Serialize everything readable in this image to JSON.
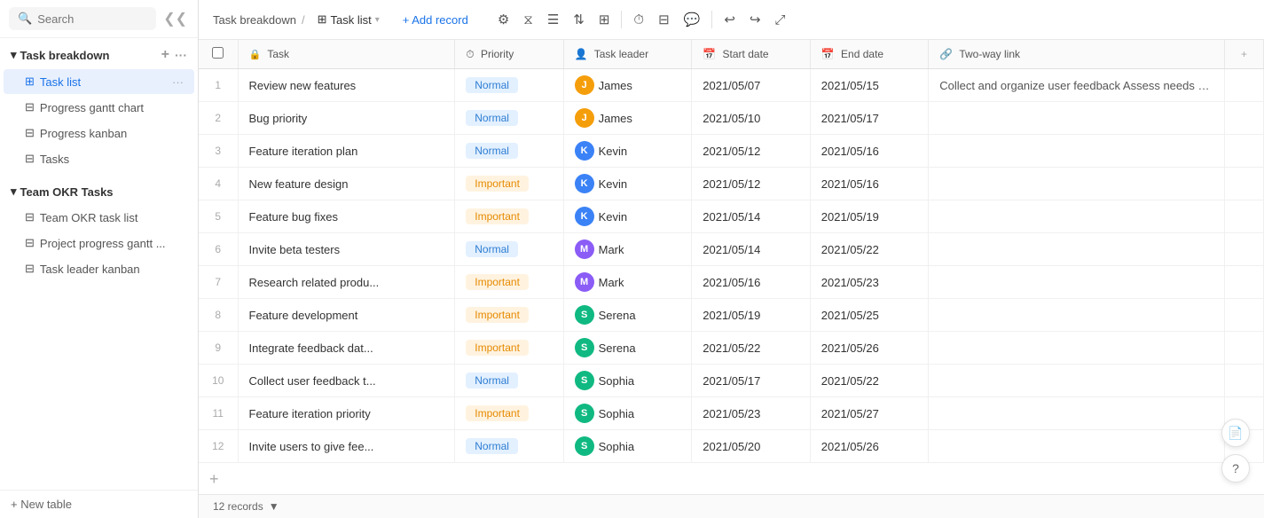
{
  "sidebar": {
    "search_placeholder": "Search",
    "collapse_icon": "❮❮",
    "groups": [
      {
        "label": "Task breakdown",
        "items": [
          {
            "id": "task-list",
            "label": "Task list",
            "icon": "⊞",
            "active": true
          },
          {
            "id": "progress-gantt",
            "label": "Progress gantt chart",
            "icon": "⊟"
          },
          {
            "id": "progress-kanban",
            "label": "Progress kanban",
            "icon": "⊟"
          },
          {
            "id": "tasks",
            "label": "Tasks",
            "icon": "⊟"
          }
        ]
      },
      {
        "label": "Team OKR Tasks",
        "items": [
          {
            "id": "team-okr-task-list",
            "label": "Team OKR task list",
            "icon": "⊟"
          },
          {
            "id": "project-progress-gantt",
            "label": "Project progress gantt ...",
            "icon": "⊟"
          },
          {
            "id": "task-leader-kanban",
            "label": "Task leader kanban",
            "icon": "⊟"
          }
        ]
      }
    ],
    "new_table_label": "+ New table"
  },
  "topbar": {
    "breadcrumb_parent": "Task breakdown",
    "breadcrumb_sep": "/",
    "view_icon": "⊞",
    "view_label": "Task list",
    "add_record_label": "+ Add record",
    "tools": [
      {
        "id": "settings",
        "icon": "⚙"
      },
      {
        "id": "filter",
        "icon": "⧖"
      },
      {
        "id": "fields",
        "icon": "☰"
      },
      {
        "id": "sort",
        "icon": "⇅"
      },
      {
        "id": "group",
        "icon": "⊞"
      },
      {
        "id": "clock",
        "icon": "⏱"
      },
      {
        "id": "table2",
        "icon": "⊟"
      },
      {
        "id": "chat",
        "icon": "💬"
      },
      {
        "id": "undo",
        "icon": "↩"
      },
      {
        "id": "redo",
        "icon": "↪"
      },
      {
        "id": "expand",
        "icon": "⤢"
      }
    ]
  },
  "table": {
    "columns": [
      {
        "id": "checkbox",
        "label": ""
      },
      {
        "id": "task",
        "label": "Task",
        "icon": "Ξ"
      },
      {
        "id": "priority",
        "label": "Priority",
        "icon": "⏱"
      },
      {
        "id": "task-leader",
        "label": "Task leader",
        "icon": "👤"
      },
      {
        "id": "start-date",
        "label": "Start date",
        "icon": "📅"
      },
      {
        "id": "end-date",
        "label": "End date",
        "icon": "📅"
      },
      {
        "id": "two-way-link",
        "label": "Two-way link",
        "icon": "🔗"
      }
    ],
    "rows": [
      {
        "num": 1,
        "task": "Review new features",
        "priority": "Normal",
        "leader": "James",
        "leader_initial": "J",
        "leader_color": "j",
        "start": "2021/05/07",
        "end": "2021/05/15",
        "link": "Collect and organize user feedback  Assess needs and div"
      },
      {
        "num": 2,
        "task": "Bug priority",
        "priority": "Normal",
        "leader": "James",
        "leader_initial": "J",
        "leader_color": "j",
        "start": "2021/05/10",
        "end": "2021/05/17",
        "link": ""
      },
      {
        "num": 3,
        "task": "Feature iteration plan",
        "priority": "Normal",
        "leader": "Kevin",
        "leader_initial": "K",
        "leader_color": "k",
        "start": "2021/05/12",
        "end": "2021/05/16",
        "link": ""
      },
      {
        "num": 4,
        "task": "New feature design",
        "priority": "Important",
        "leader": "Kevin",
        "leader_initial": "K",
        "leader_color": "k",
        "start": "2021/05/12",
        "end": "2021/05/16",
        "link": ""
      },
      {
        "num": 5,
        "task": "Feature bug fixes",
        "priority": "Important",
        "leader": "Kevin",
        "leader_initial": "K",
        "leader_color": "k",
        "start": "2021/05/14",
        "end": "2021/05/19",
        "link": ""
      },
      {
        "num": 6,
        "task": "Invite beta testers",
        "priority": "Normal",
        "leader": "Mark",
        "leader_initial": "M",
        "leader_color": "m",
        "start": "2021/05/14",
        "end": "2021/05/22",
        "link": ""
      },
      {
        "num": 7,
        "task": "Research related produ...",
        "priority": "Important",
        "leader": "Mark",
        "leader_initial": "M",
        "leader_color": "m",
        "start": "2021/05/16",
        "end": "2021/05/23",
        "link": ""
      },
      {
        "num": 8,
        "task": "Feature development",
        "priority": "Important",
        "leader": "Serena",
        "leader_initial": "S",
        "leader_color": "s",
        "start": "2021/05/19",
        "end": "2021/05/25",
        "link": ""
      },
      {
        "num": 9,
        "task": "Integrate feedback dat...",
        "priority": "Important",
        "leader": "Serena",
        "leader_initial": "S",
        "leader_color": "s",
        "start": "2021/05/22",
        "end": "2021/05/26",
        "link": ""
      },
      {
        "num": 10,
        "task": "Collect user feedback t...",
        "priority": "Normal",
        "leader": "Sophia",
        "leader_initial": "S",
        "leader_color": "s",
        "start": "2021/05/17",
        "end": "2021/05/22",
        "link": ""
      },
      {
        "num": 11,
        "task": "Feature iteration priority",
        "priority": "Important",
        "leader": "Sophia",
        "leader_initial": "S",
        "leader_color": "s",
        "start": "2021/05/23",
        "end": "2021/05/27",
        "link": ""
      },
      {
        "num": 12,
        "task": "Invite users to give fee...",
        "priority": "Normal",
        "leader": "Sophia",
        "leader_initial": "S",
        "leader_color": "s",
        "start": "2021/05/20",
        "end": "2021/05/26",
        "link": ""
      }
    ]
  },
  "bottom_bar": {
    "records_label": "12 records",
    "chevron": "▼"
  }
}
